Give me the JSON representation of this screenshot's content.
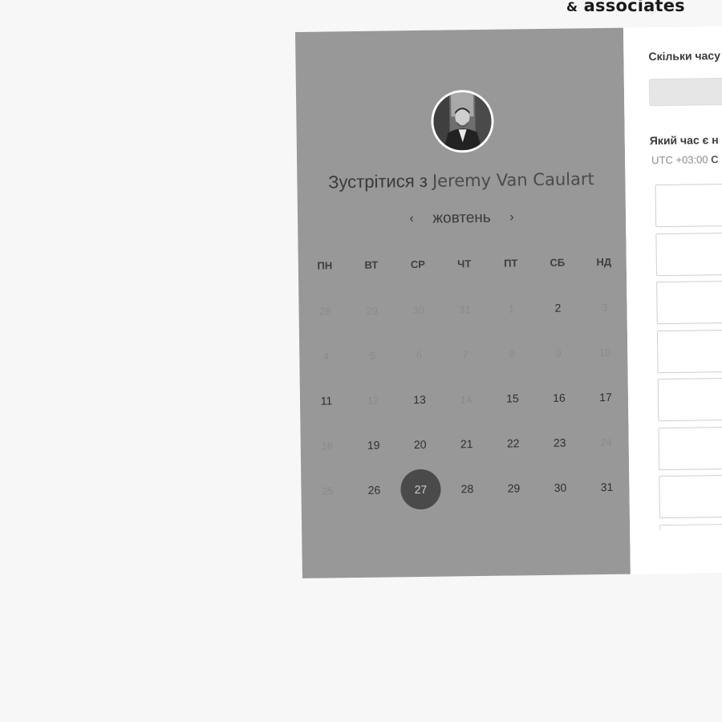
{
  "brand": {
    "amp": "&",
    "name": "associates"
  },
  "booking": {
    "title_prefix": "Зустрітися з",
    "host_name": "Jeremy Van Caulart",
    "month": "жовтень",
    "weekdays": [
      "ПН",
      "ВТ",
      "СР",
      "ЧТ",
      "ПТ",
      "СБ",
      "НД"
    ],
    "days": [
      {
        "n": "28",
        "s": "muted"
      },
      {
        "n": "29",
        "s": "muted"
      },
      {
        "n": "30",
        "s": "muted"
      },
      {
        "n": "31",
        "s": "muted"
      },
      {
        "n": "1",
        "s": "muted"
      },
      {
        "n": "2",
        "s": "available"
      },
      {
        "n": "3",
        "s": "muted"
      },
      {
        "n": "4",
        "s": "muted"
      },
      {
        "n": "5",
        "s": "muted"
      },
      {
        "n": "6",
        "s": "muted"
      },
      {
        "n": "7",
        "s": "muted"
      },
      {
        "n": "8",
        "s": "muted"
      },
      {
        "n": "9",
        "s": "muted"
      },
      {
        "n": "10",
        "s": "muted"
      },
      {
        "n": "11",
        "s": "available"
      },
      {
        "n": "12",
        "s": "muted"
      },
      {
        "n": "13",
        "s": "available"
      },
      {
        "n": "14",
        "s": "muted"
      },
      {
        "n": "15",
        "s": "available"
      },
      {
        "n": "16",
        "s": "available"
      },
      {
        "n": "17",
        "s": "available"
      },
      {
        "n": "18",
        "s": "muted"
      },
      {
        "n": "19",
        "s": "available"
      },
      {
        "n": "20",
        "s": "available"
      },
      {
        "n": "21",
        "s": "available"
      },
      {
        "n": "22",
        "s": "available"
      },
      {
        "n": "23",
        "s": "available"
      },
      {
        "n": "24",
        "s": "muted"
      },
      {
        "n": "25",
        "s": "muted"
      },
      {
        "n": "26",
        "s": "available"
      },
      {
        "n": "27",
        "s": "selected"
      },
      {
        "n": "28",
        "s": "available"
      },
      {
        "n": "29",
        "s": "available"
      },
      {
        "n": "30",
        "s": "available"
      },
      {
        "n": "31",
        "s": "available"
      }
    ]
  },
  "details": {
    "duration_label": "Скільки часу",
    "time_label": "Який час є н",
    "timezone_prefix": "UTC +03:00",
    "timezone_suffix": "С",
    "time_slot_count_visible": 8
  },
  "colors": {
    "left_panel": "#989898",
    "selected_day": "#4a4a4a",
    "page_bg": "#f7f7f7"
  },
  "icons": {
    "prev": "‹",
    "next": "›"
  }
}
